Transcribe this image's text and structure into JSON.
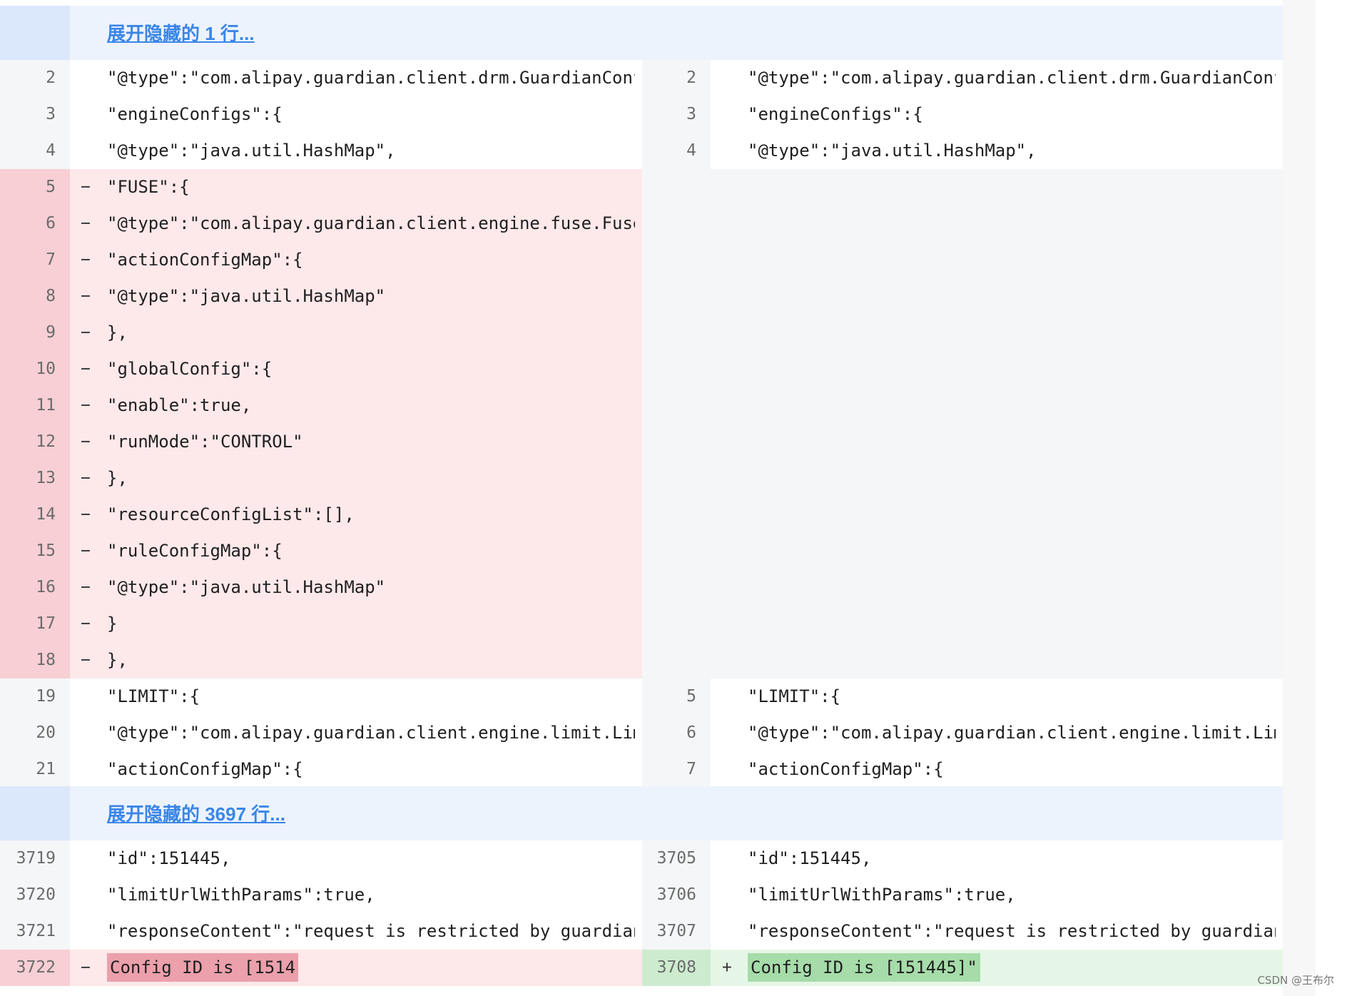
{
  "expanders": [
    {
      "label": "展开隐藏的 1 行..."
    },
    {
      "label": "展开隐藏的 3697 行..."
    }
  ],
  "rows_top": [
    {
      "l_ln": "2",
      "l_mk": "",
      "l_code": "\"@type\":\"com.alipay.guardian.client.drm.GuardianConfig",
      "r_ln": "2",
      "r_mk": "",
      "r_code": "\"@type\":\"com.alipay.guardian.client.drm.GuardianConfig",
      "type": "ctx"
    },
    {
      "l_ln": "3",
      "l_mk": "",
      "l_code": "\"engineConfigs\":{",
      "r_ln": "3",
      "r_mk": "",
      "r_code": "\"engineConfigs\":{",
      "type": "ctx"
    },
    {
      "l_ln": "4",
      "l_mk": "",
      "l_code": "\"@type\":\"java.util.HashMap\",",
      "r_ln": "4",
      "r_mk": "",
      "r_code": "\"@type\":\"java.util.HashMap\",",
      "type": "ctx"
    },
    {
      "l_ln": "5",
      "l_mk": "−",
      "l_code": "\"FUSE\":{",
      "r_ln": "",
      "r_mk": "",
      "r_code": "",
      "type": "del"
    },
    {
      "l_ln": "6",
      "l_mk": "−",
      "l_code": "\"@type\":\"com.alipay.guardian.client.engine.fuse.FuseEn",
      "r_ln": "",
      "r_mk": "",
      "r_code": "",
      "type": "del"
    },
    {
      "l_ln": "7",
      "l_mk": "−",
      "l_code": "\"actionConfigMap\":{",
      "r_ln": "",
      "r_mk": "",
      "r_code": "",
      "type": "del"
    },
    {
      "l_ln": "8",
      "l_mk": "−",
      "l_code": "\"@type\":\"java.util.HashMap\"",
      "r_ln": "",
      "r_mk": "",
      "r_code": "",
      "type": "del"
    },
    {
      "l_ln": "9",
      "l_mk": "−",
      "l_code": "},",
      "r_ln": "",
      "r_mk": "",
      "r_code": "",
      "type": "del"
    },
    {
      "l_ln": "10",
      "l_mk": "−",
      "l_code": "\"globalConfig\":{",
      "r_ln": "",
      "r_mk": "",
      "r_code": "",
      "type": "del"
    },
    {
      "l_ln": "11",
      "l_mk": "−",
      "l_code": "\"enable\":true,",
      "r_ln": "",
      "r_mk": "",
      "r_code": "",
      "type": "del"
    },
    {
      "l_ln": "12",
      "l_mk": "−",
      "l_code": "\"runMode\":\"CONTROL\"",
      "r_ln": "",
      "r_mk": "",
      "r_code": "",
      "type": "del"
    },
    {
      "l_ln": "13",
      "l_mk": "−",
      "l_code": "},",
      "r_ln": "",
      "r_mk": "",
      "r_code": "",
      "type": "del"
    },
    {
      "l_ln": "14",
      "l_mk": "−",
      "l_code": "\"resourceConfigList\":[],",
      "r_ln": "",
      "r_mk": "",
      "r_code": "",
      "type": "del"
    },
    {
      "l_ln": "15",
      "l_mk": "−",
      "l_code": "\"ruleConfigMap\":{",
      "r_ln": "",
      "r_mk": "",
      "r_code": "",
      "type": "del"
    },
    {
      "l_ln": "16",
      "l_mk": "−",
      "l_code": "\"@type\":\"java.util.HashMap\"",
      "r_ln": "",
      "r_mk": "",
      "r_code": "",
      "type": "del"
    },
    {
      "l_ln": "17",
      "l_mk": "−",
      "l_code": "}",
      "r_ln": "",
      "r_mk": "",
      "r_code": "",
      "type": "del"
    },
    {
      "l_ln": "18",
      "l_mk": "−",
      "l_code": "},",
      "r_ln": "",
      "r_mk": "",
      "r_code": "",
      "type": "del"
    },
    {
      "l_ln": "19",
      "l_mk": "",
      "l_code": "\"LIMIT\":{",
      "r_ln": "5",
      "r_mk": "",
      "r_code": "\"LIMIT\":{",
      "type": "ctx"
    },
    {
      "l_ln": "20",
      "l_mk": "",
      "l_code": "\"@type\":\"com.alipay.guardian.client.engine.limit.Limit",
      "r_ln": "6",
      "r_mk": "",
      "r_code": "\"@type\":\"com.alipay.guardian.client.engine.limit.Limit",
      "type": "ctx"
    },
    {
      "l_ln": "21",
      "l_mk": "",
      "l_code": "\"actionConfigMap\":{",
      "r_ln": "7",
      "r_mk": "",
      "r_code": "\"actionConfigMap\":{",
      "type": "ctx"
    }
  ],
  "rows_bottom": [
    {
      "l_ln": "3719",
      "l_mk": "",
      "l_code": "\"id\":151445,",
      "r_ln": "3705",
      "r_mk": "",
      "r_code": "\"id\":151445,",
      "type": "ctx"
    },
    {
      "l_ln": "3720",
      "l_mk": "",
      "l_code": "\"limitUrlWithParams\":true,",
      "r_ln": "3706",
      "r_mk": "",
      "r_code": "\"limitUrlWithParams\":true,",
      "type": "ctx"
    },
    {
      "l_ln": "3721",
      "l_mk": "",
      "l_code": "\"responseContent\":\"request is restricted by guardian,",
      "r_ln": "3707",
      "r_mk": "",
      "r_code": "\"responseContent\":\"request is restricted by guardian,",
      "type": "ctx"
    },
    {
      "l_ln": "3722",
      "l_mk": "−",
      "l_code": "Config ID is [1514",
      "r_ln": "3708",
      "r_mk": "+",
      "r_code": "Config ID is [151445]\"",
      "type": "change"
    }
  ],
  "credit": "CSDN @王布尔"
}
